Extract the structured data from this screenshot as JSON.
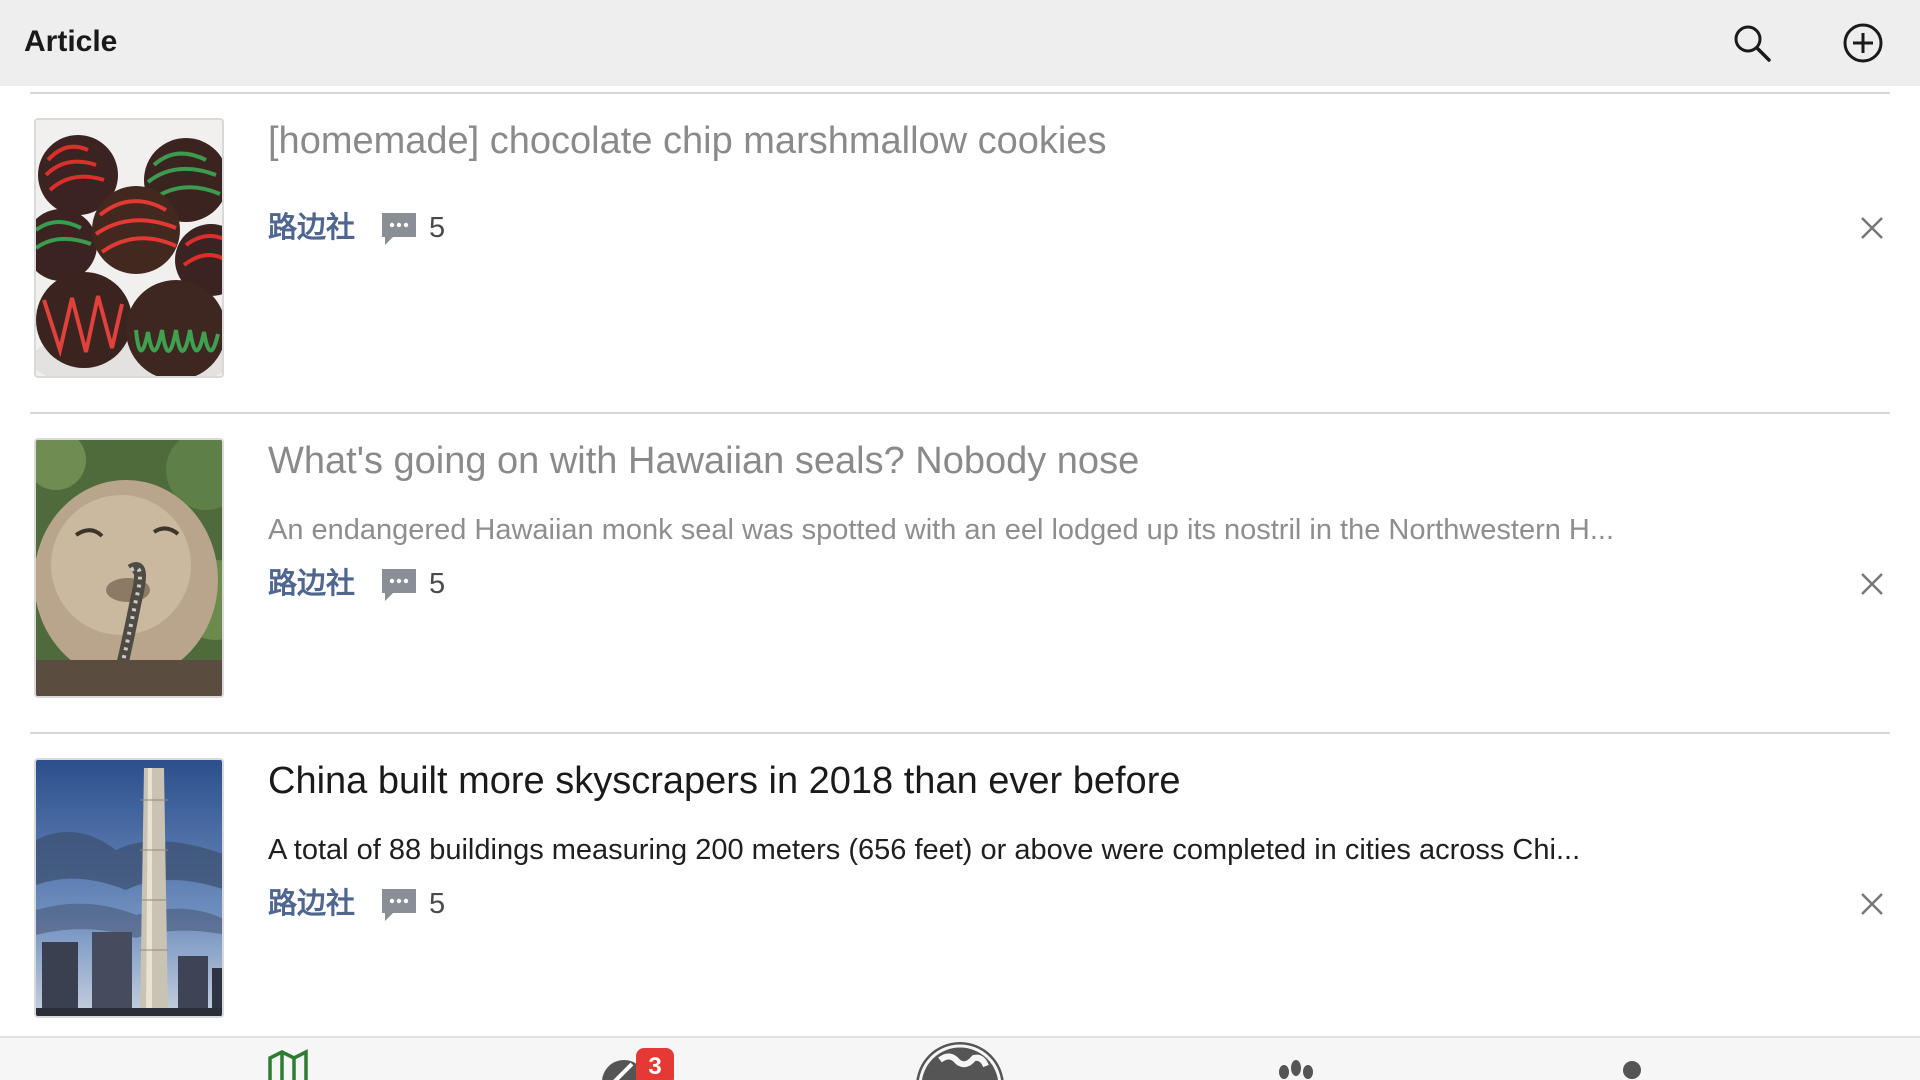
{
  "header": {
    "title": "Article",
    "search_icon": "search-icon",
    "add_icon": "plus-circle-icon"
  },
  "articles": [
    {
      "title": "[homemade] chocolate chip marshmallow cookies",
      "summary": "",
      "source": "路边社",
      "comment_count": "5",
      "read": true,
      "thumbnail": "chocolate-cookies-image"
    },
    {
      "title": "What's going on with Hawaiian seals? Nobody nose",
      "summary": "An endangered Hawaiian monk seal was spotted with an eel lodged up its nostril in the Northwestern H...",
      "source": "路边社",
      "comment_count": "5",
      "read": true,
      "thumbnail": "monk-seal-image"
    },
    {
      "title": "China built more skyscrapers in 2018 than ever before",
      "summary": "A total of 88 buildings measuring 200 meters (656 feet) or above were completed in cities across Chi...",
      "source": "路边社",
      "comment_count": "5",
      "read": false,
      "thumbnail": "skyscraper-image"
    }
  ],
  "bottom_nav": {
    "items": [
      "map-icon",
      "rocket-icon",
      "globe-icon",
      "paw-icon",
      "more-icon"
    ],
    "badge": "3"
  },
  "colors": {
    "header_bg": "#eeeeee",
    "source_link": "#4f6691",
    "read_text": "#8a8a8a",
    "badge": "#e53935",
    "accent_green": "#2e7d32"
  }
}
